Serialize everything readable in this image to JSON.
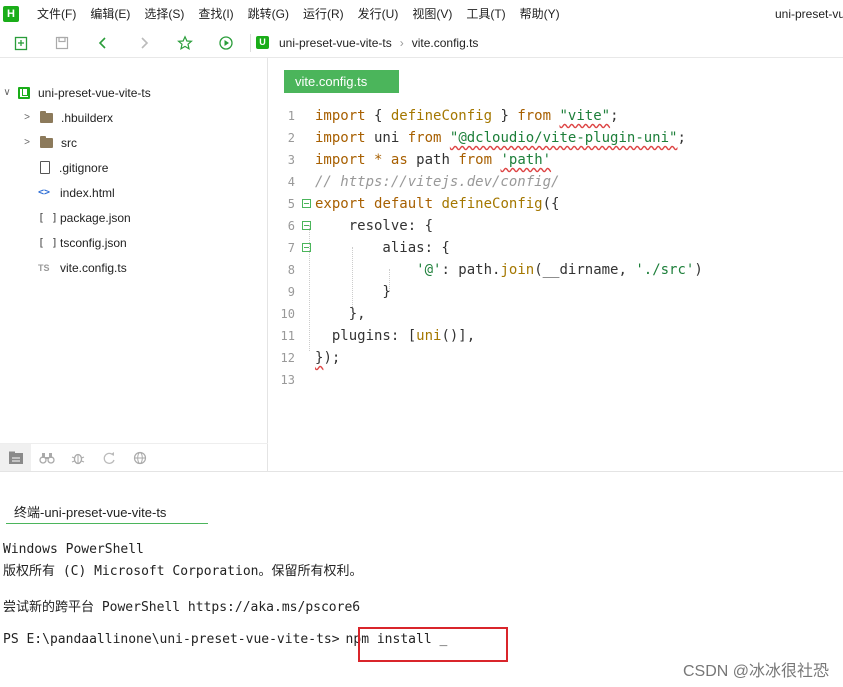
{
  "app": {
    "logo_letter": "H",
    "window_title": "uni-preset-vue-vite-ts"
  },
  "menu": [
    "文件(F)",
    "编辑(E)",
    "选择(S)",
    "查找(I)",
    "跳转(G)",
    "运行(R)",
    "发行(U)",
    "视图(V)",
    "工具(T)",
    "帮助(Y)"
  ],
  "breadcrumb": {
    "logo": "U",
    "project": "uni-preset-vue-vite-ts",
    "separator": "›",
    "file": "vite.config.ts"
  },
  "sidebar": {
    "project_arrow": "∨",
    "project_name": "uni-preset-vue-vite-ts",
    "items": [
      {
        "label": ".hbuilderx",
        "icon": "folder-icon",
        "arrow": ">"
      },
      {
        "label": "src",
        "icon": "folder-icon",
        "arrow": ">"
      },
      {
        "label": ".gitignore",
        "icon": "file-icon"
      },
      {
        "label": "index.html",
        "icon": "html-code-icon",
        "glyph": "<>"
      },
      {
        "label": "package.json",
        "icon": "json-bracket-icon",
        "glyph": "[ ]"
      },
      {
        "label": "tsconfig.json",
        "icon": "json-bracket-icon",
        "glyph": "[ ]"
      },
      {
        "label": "vite.config.ts",
        "icon": "ts-file-icon",
        "glyph": "TS"
      }
    ]
  },
  "editor": {
    "tab_label": "vite.config.ts",
    "line_numbers": [
      "1",
      "2",
      "3",
      "4",
      "5",
      "6",
      "7",
      "8",
      "9",
      "10",
      "11",
      "12",
      "13"
    ]
  },
  "terminal": {
    "tab_label": "终端-uni-preset-vue-vite-ts",
    "lines": [
      "Windows PowerShell",
      "版权所有 (C) Microsoft Corporation。保留所有权利。",
      "",
      "尝试新的跨平台 PowerShell https://aka.ms/pscore6"
    ],
    "prompt": "PS E:\\pandaallinone\\uni-preset-vue-vite-ts>",
    "command": "npm install _"
  },
  "watermark": "CSDN @冰冰很社恐",
  "colors": {
    "accent_green": "#4bb55b",
    "highlight_red": "#d9252b"
  }
}
